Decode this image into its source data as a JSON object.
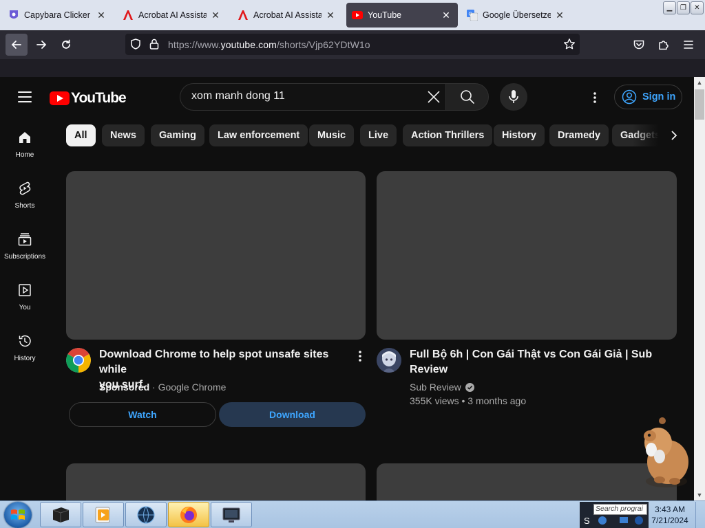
{
  "browser": {
    "tabs": [
      {
        "label": "Capybara Clicker 🐀",
        "icon": "capybara-extension-icon",
        "active": false
      },
      {
        "label": "Acrobat AI Assistant",
        "icon": "adobe-acrobat-icon",
        "active": false
      },
      {
        "label": "Acrobat AI Assistant",
        "icon": "adobe-acrobat-icon",
        "active": false
      },
      {
        "label": "YouTube",
        "icon": "youtube-icon",
        "active": true
      },
      {
        "label": "Google Übersetzer",
        "icon": "google-translate-icon",
        "active": false
      }
    ],
    "url_prefix": "https://www.",
    "url_host": "youtube.com",
    "url_path": "/shorts/Vjp62YDtW1o"
  },
  "youtube": {
    "logo_text": "YouTube",
    "search_query": "xom manh dong 11",
    "signin_label": "Sign in",
    "guide": [
      {
        "label": "Home",
        "icon": "home-icon"
      },
      {
        "label": "Shorts",
        "icon": "shorts-icon"
      },
      {
        "label": "Subscriptions",
        "icon": "subscriptions-icon"
      },
      {
        "label": "You",
        "icon": "you-icon"
      },
      {
        "label": "History",
        "icon": "history-icon"
      }
    ],
    "chips": [
      "All",
      "News",
      "Gaming",
      "Law enforcement",
      "Music",
      "Live",
      "Action Thrillers",
      "History",
      "Dramedy",
      "Gadgets"
    ],
    "selected_chip": "All",
    "ad_card": {
      "title_line1": "Download Chrome to help spot unsafe sites while",
      "title_line2": "you surf.",
      "sponsored_label": "Sponsored",
      "separator": "·",
      "advertiser": "Google Chrome",
      "watch_label": "Watch",
      "download_label": "Download"
    },
    "video_card": {
      "title_line1": "Full Bộ 6h | Con Gái Thật vs Con Gái Giả | Sub",
      "title_line2": "Review",
      "channel": "Sub Review",
      "verified": true,
      "views": "355K views",
      "separator": "•",
      "age": "3 months ago"
    }
  },
  "taskbar": {
    "search_placeholder": "Search prograi",
    "time": "3:43 AM",
    "date": "7/21/2024"
  },
  "colors": {
    "yt_bg": "#0f0f0f",
    "chip_bg": "#272727",
    "thumb_placeholder": "#3d3d3d",
    "link_blue": "#3ea6ff",
    "yt_red": "#ff0000"
  }
}
